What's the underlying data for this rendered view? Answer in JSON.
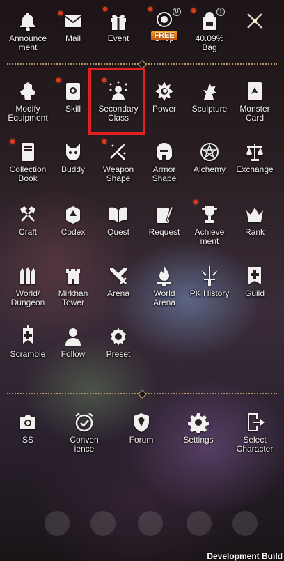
{
  "top_row": [
    {
      "label": "Announce\nment",
      "icon": "bell-icon"
    },
    {
      "label": "Mail",
      "icon": "envelope-icon"
    },
    {
      "label": "Event",
      "icon": "gift-icon"
    },
    {
      "label": "Shop",
      "icon": "shop-icon",
      "badge_text": "FREE"
    },
    {
      "label": "40.09%\nBag",
      "icon": "backpack-icon"
    },
    {
      "label": "",
      "icon": "close-icon"
    }
  ],
  "menu": [
    {
      "label": "Modify\nEquipment",
      "icon": "armor-icon"
    },
    {
      "label": "Skill",
      "icon": "skill-book-icon"
    },
    {
      "label": "Secondary\nClass",
      "icon": "secondary-class-icon"
    },
    {
      "label": "Power",
      "icon": "power-icon"
    },
    {
      "label": "Sculpture",
      "icon": "dragon-icon"
    },
    {
      "label": "Monster\nCard",
      "icon": "monster-card-icon"
    },
    {
      "label": "Collection\nBook",
      "icon": "collection-book-icon"
    },
    {
      "label": "Buddy",
      "icon": "cat-icon"
    },
    {
      "label": "Weapon\nShape",
      "icon": "swords-sparkle-icon"
    },
    {
      "label": "Armor\nShape",
      "icon": "helmet-icon"
    },
    {
      "label": "Alchemy",
      "icon": "pentagram-icon"
    },
    {
      "label": "Exchange",
      "icon": "scales-icon"
    },
    {
      "label": "Craft",
      "icon": "hammers-icon"
    },
    {
      "label": "Codex",
      "icon": "codex-icon"
    },
    {
      "label": "Quest",
      "icon": "open-book-icon"
    },
    {
      "label": "Request",
      "icon": "scroll-quill-icon"
    },
    {
      "label": "Achieve\nment",
      "icon": "trophy-icon"
    },
    {
      "label": "Rank",
      "icon": "crown-icon"
    },
    {
      "label": "World/\nDungeon",
      "icon": "dungeon-icon"
    },
    {
      "label": "Mirkhan\nTower",
      "icon": "tower-icon"
    },
    {
      "label": "Arena",
      "icon": "crossed-swords-icon"
    },
    {
      "label": "World\nArena",
      "icon": "flame-brazier-icon"
    },
    {
      "label": "PK History",
      "icon": "pk-sword-icon"
    },
    {
      "label": "Guild",
      "icon": "guild-banner-icon"
    },
    {
      "label": "Scramble",
      "icon": "scramble-banner-icon"
    },
    {
      "label": "Follow",
      "icon": "user-add-icon"
    },
    {
      "label": "Preset",
      "icon": "preset-gear-icon"
    }
  ],
  "bottom_row": [
    {
      "label": "SS",
      "icon": "camera-icon"
    },
    {
      "label": "Conven\nience",
      "icon": "alarm-clock-icon"
    },
    {
      "label": "Forum",
      "icon": "shield-crest-icon"
    },
    {
      "label": "Settings",
      "icon": "gear-icon"
    },
    {
      "label": "Select\nCharacter",
      "icon": "exit-door-icon"
    }
  ],
  "top_badges": [
    "U",
    "!"
  ],
  "footer": {
    "text": "Development Build"
  },
  "colors": {
    "accent_gold": "#b59a63",
    "highlight_red": "#e12020",
    "notification_red": "#e23b1a"
  }
}
